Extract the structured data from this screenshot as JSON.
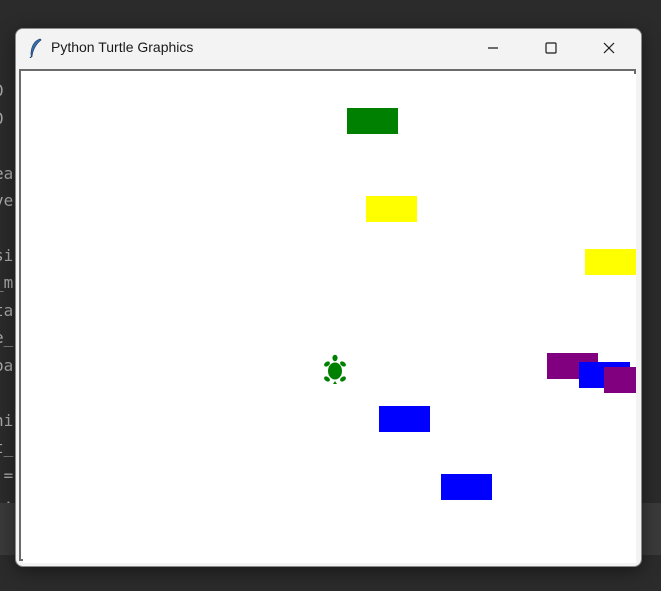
{
  "window": {
    "title": "Python Turtle Graphics",
    "controls": {
      "minimize": "minimize",
      "maximize": "maximize",
      "close": "close"
    }
  },
  "background_code_fragments": [
    "0",
    "0",
    "ea",
    "ve",
    "si",
    "_m",
    "ta",
    "e_",
    "oa",
    "hi",
    "t_",
    " =",
    " ."
  ],
  "colors": {
    "green": "#008000",
    "yellow": "#ffff00",
    "blue": "#0000ff",
    "purple": "#800080",
    "canvas": "#ffffff"
  },
  "shapes": [
    {
      "name": "green-rectangle",
      "color": "green"
    },
    {
      "name": "yellow-rectangle-1",
      "color": "yellow"
    },
    {
      "name": "yellow-rectangle-2",
      "color": "yellow"
    },
    {
      "name": "purple-rectangle-1",
      "color": "purple"
    },
    {
      "name": "blue-rectangle-1",
      "color": "blue"
    },
    {
      "name": "purple-rectangle-2",
      "color": "purple"
    },
    {
      "name": "blue-rectangle-2",
      "color": "blue"
    },
    {
      "name": "blue-rectangle-3",
      "color": "blue"
    }
  ],
  "turtle": {
    "color": "green",
    "icon": "turtle-icon"
  }
}
